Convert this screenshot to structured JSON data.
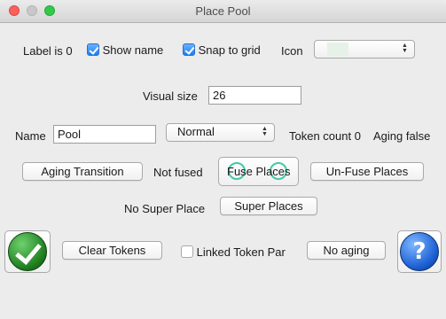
{
  "window": {
    "title": "Place Pool"
  },
  "row1": {
    "label_text": "Label is 0",
    "show_name": {
      "label": "Show name",
      "checked": true
    },
    "snap_to_grid": {
      "label": "Snap to grid",
      "checked": true
    },
    "icon_label": "Icon",
    "icon_select": {
      "value": "",
      "swatch_color": "#e6f2e8"
    }
  },
  "visual_size": {
    "label": "Visual size",
    "value": "26"
  },
  "row3": {
    "name_label": "Name",
    "name_value": "Pool",
    "mode_select": "Normal",
    "token_count": "Token count 0",
    "aging": "Aging false"
  },
  "row4": {
    "aging_transition": "Aging Transition",
    "fused_status": "Not fused",
    "fuse_places": "Fuse Places",
    "unfuse_places": "Un-Fuse Places"
  },
  "row5": {
    "super_place_status": "No Super Place",
    "super_places": "Super Places"
  },
  "row6": {
    "ok_icon": "green-check-icon",
    "clear_tokens": "Clear Tokens",
    "linked_token": {
      "label": "Linked Token Par",
      "checked": false
    },
    "no_aging": "No aging",
    "help_icon": "blue-question-icon"
  },
  "colors": {
    "checkbox_on": "#1b7ef2",
    "fuse_circles": "#46c8a8",
    "ok": "#1c7a1c",
    "help": "#1c5fd4"
  }
}
